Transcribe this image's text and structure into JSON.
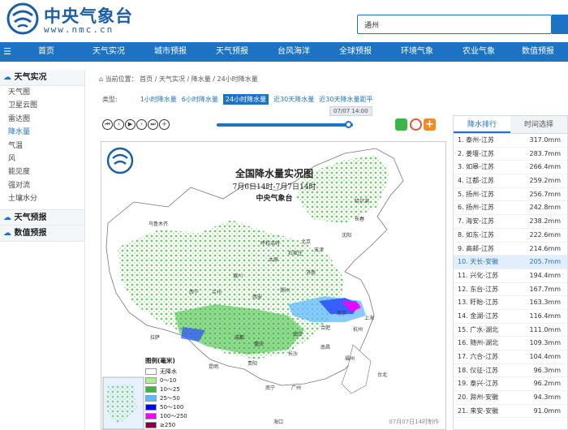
{
  "header": {
    "logo_cn": "中央气象台",
    "logo_en": "www.nmc.cn",
    "search_value": "通州"
  },
  "nav": {
    "items": [
      "首页",
      "天气实况",
      "城市预报",
      "天气预报",
      "台风海洋",
      "全球预报",
      "环境气象",
      "农业气象",
      "数值预报"
    ]
  },
  "sidebar": {
    "section_live": "天气实况",
    "items": [
      "天气图",
      "卫星云图",
      "雷达图",
      "降水量",
      "气温",
      "风",
      "能见度",
      "强对流",
      "土壤水分"
    ],
    "active_index": 3,
    "section_forecast": "天气预报",
    "section_numeric": "数值预报"
  },
  "breadcrumb": {
    "label": "当前位置：",
    "path": [
      "首页",
      "天气实况",
      "降水量",
      "24小时降水量"
    ]
  },
  "type_row": {
    "label": "类型:",
    "links": [
      "1小时降水量",
      "6小时降水量",
      "24小时降水量",
      "近30天降水量",
      "近30天降水量距平"
    ],
    "active_index": 2
  },
  "slider": {
    "tooltip": "07/07 14:00",
    "progress": 0.97
  },
  "map": {
    "title": "全国降水量实况图",
    "subtitle": "7月6日14时-7月7日14时",
    "org": "中央气象台",
    "cities": [
      "哈尔滨",
      "长春",
      "沈阳",
      "北京",
      "天津",
      "石家庄",
      "太原",
      "呼和浩特",
      "济南",
      "郑州",
      "西安",
      "兰州",
      "西宁",
      "银川",
      "成都",
      "重庆",
      "贵阳",
      "昆明",
      "南宁",
      "广州",
      "武汉",
      "长沙",
      "南京",
      "上海",
      "杭州",
      "合肥",
      "南昌",
      "福州",
      "台北",
      "海口",
      "拉萨",
      "乌鲁木齐"
    ],
    "legend_title": "图例(毫米)",
    "legend": [
      {
        "label": "无降水",
        "color": "#ffffff"
      },
      {
        "label": "0～10",
        "color": "#a6f28f"
      },
      {
        "label": "10～25",
        "color": "#3dba3d"
      },
      {
        "label": "25～50",
        "color": "#61b8ff"
      },
      {
        "label": "50～100",
        "color": "#0000ff"
      },
      {
        "label": "100～250",
        "color": "#fa00fa"
      },
      {
        "label": "≥250",
        "color": "#800040"
      }
    ],
    "timestamp": "07月07日14时制作"
  },
  "rank": {
    "tab_rank": "降水排行",
    "tab_time": "时间选择",
    "highlight_index": 9,
    "rows": [
      {
        "name": "1. 泰州-江苏",
        "value": "317.0mm"
      },
      {
        "name": "2. 姜堰-江苏",
        "value": "283.7mm"
      },
      {
        "name": "3. 如皋-江苏",
        "value": "266.4mm"
      },
      {
        "name": "4. 江都-江苏",
        "value": "259.2mm"
      },
      {
        "name": "5. 扬州-江苏",
        "value": "256.7mm"
      },
      {
        "name": "6. 扬州-江苏",
        "value": "242.8mm"
      },
      {
        "name": "7. 海安-江苏",
        "value": "238.2mm"
      },
      {
        "name": "8. 如东-江苏",
        "value": "222.6mm"
      },
      {
        "name": "9. 高邮-江苏",
        "value": "214.6mm"
      },
      {
        "name": "10. 天长-安徽",
        "value": "205.7mm"
      },
      {
        "name": "11. 兴化-江苏",
        "value": "194.4mm"
      },
      {
        "name": "12. 东台-江苏",
        "value": "167.7mm"
      },
      {
        "name": "13. 盱眙-江苏",
        "value": "163.3mm"
      },
      {
        "name": "14. 金湖-江苏",
        "value": "116.4mm"
      },
      {
        "name": "15. 广水-湖北",
        "value": "111.0mm"
      },
      {
        "name": "16. 随州-湖北",
        "value": "109.3mm"
      },
      {
        "name": "17. 六合-江苏",
        "value": "104.4mm"
      },
      {
        "name": "18. 仪征-江苏",
        "value": "96.3mm"
      },
      {
        "name": "19. 泰兴-江苏",
        "value": "96.2mm"
      },
      {
        "name": "20. 滁州-安徽",
        "value": "94.3mm"
      },
      {
        "name": "21. 来安-安徽",
        "value": "91.0mm"
      }
    ]
  }
}
